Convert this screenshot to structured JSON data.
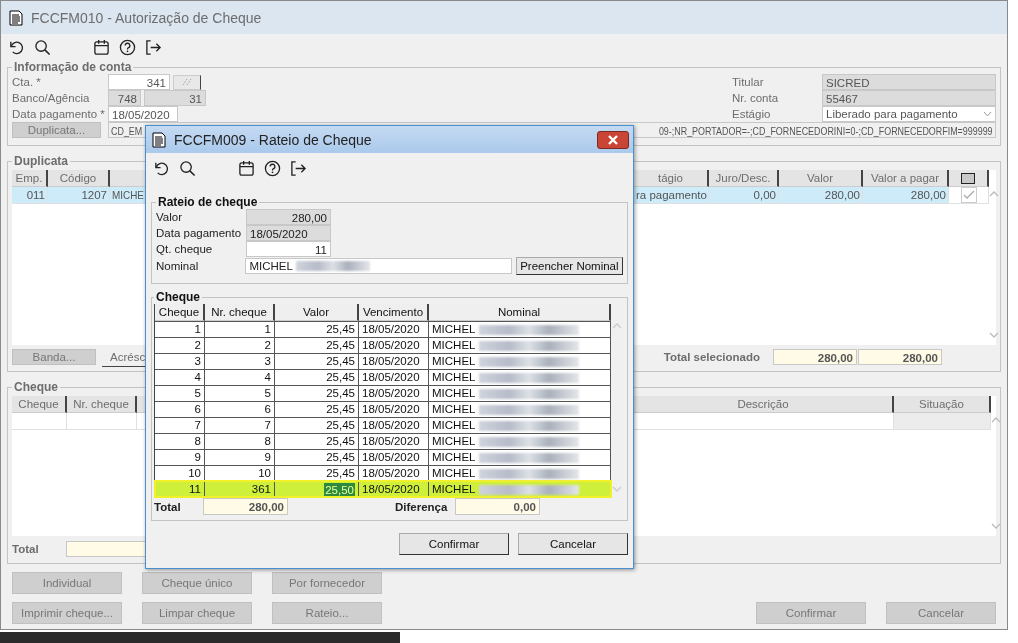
{
  "main_window": {
    "title": "FCCFM010 - Autorização de Cheque"
  },
  "account": {
    "title": "Informação de conta",
    "cta": {
      "label": "Cta. *",
      "value": "341"
    },
    "banco_agencia": {
      "label": "Banco/Agência",
      "banco": "748",
      "agencia": "31"
    },
    "data_pagamento": {
      "label": "Data pagamento *",
      "value": "18/05/2020"
    },
    "duplicata_button": "Duplicata...",
    "filter_start": "CD_EM",
    "filter_end": "09-;NR_PORTADOR=-;CD_FORNECEDORINI=0-;CD_FORNECEDORFIM=999999",
    "titular": {
      "label": "Titular",
      "value": "SICRED"
    },
    "nr_conta": {
      "label": "Nr. conta",
      "value": "55467"
    },
    "estagio": {
      "label": "Estágio",
      "value": "Liberado para pagamento"
    }
  },
  "duplicata": {
    "title": "Duplicata",
    "columns": [
      {
        "kind": "text",
        "label": "Emp."
      },
      {
        "kind": "text",
        "label": "Código"
      },
      {
        "kind": "covered"
      },
      {
        "kind": "text",
        "label": "tágio"
      },
      {
        "kind": "text",
        "label": "Juro/Desc."
      },
      {
        "kind": "text",
        "label": "Valor"
      },
      {
        "kind": "text",
        "label": "Valor a pagar"
      },
      {
        "kind": "checkbox"
      }
    ],
    "rows": [
      {
        "selected": true,
        "cells": [
          "011",
          "1207",
          "MICHE",
          "ra pagamento",
          "0,00",
          "280,00",
          "280,00"
        ],
        "checked": true
      }
    ],
    "banda_button": "Banda...",
    "acresc_tab": "Acrésc",
    "total_label": "Total selecionado",
    "totals": [
      "280,00",
      "280,00"
    ]
  },
  "cheque": {
    "title": "Cheque",
    "columns": [
      {
        "kind": "text",
        "label": "Cheque"
      },
      {
        "kind": "text",
        "label": "Nr. cheque"
      },
      {
        "kind": "covered"
      },
      {
        "kind": "text",
        "label": "Descrição"
      },
      {
        "kind": "text",
        "label": "Situação"
      }
    ],
    "total_label": "Total"
  },
  "button_rows": [
    [
      "Individual",
      "Cheque único",
      "Por fornecedor"
    ],
    [
      "Imprimir cheque...",
      "Limpar cheque",
      "Rateio..."
    ]
  ],
  "footer_buttons": [
    "Confirmar",
    "Cancelar"
  ],
  "dialog": {
    "title": "FCCFM009 - Rateio de Cheque",
    "rateio": {
      "title": "Rateio de cheque",
      "fields": [
        {
          "label": "Valor",
          "value": "280,00",
          "readonly": true
        },
        {
          "label": "Data pagamento",
          "value": "18/05/2020",
          "readonly": true
        },
        {
          "label": "Qt. cheque",
          "value": "11",
          "readonly": false
        }
      ],
      "nominal": {
        "label": "Nominal",
        "value": "MICHEL",
        "blurred": true
      },
      "fill_button": "Preencher Nominal"
    },
    "cheques": {
      "title": "Cheque",
      "columns": [
        "Cheque",
        "Nr. cheque",
        "Valor",
        "Vencimento",
        "Nominal"
      ],
      "rows": [
        {
          "selected": false,
          "editing": false,
          "cheque": "1",
          "nr_cheque": "1",
          "valor": "25,45",
          "vencimento": "18/05/2020",
          "nominal": "MICHEL",
          "blurred": true
        },
        {
          "selected": false,
          "editing": false,
          "cheque": "2",
          "nr_cheque": "2",
          "valor": "25,45",
          "vencimento": "18/05/2020",
          "nominal": "MICHEL",
          "blurred": true
        },
        {
          "selected": false,
          "editing": false,
          "cheque": "3",
          "nr_cheque": "3",
          "valor": "25,45",
          "vencimento": "18/05/2020",
          "nominal": "MICHEL",
          "blurred": true
        },
        {
          "selected": false,
          "editing": false,
          "cheque": "4",
          "nr_cheque": "4",
          "valor": "25,45",
          "vencimento": "18/05/2020",
          "nominal": "MICHEL",
          "blurred": true
        },
        {
          "selected": false,
          "editing": false,
          "cheque": "5",
          "nr_cheque": "5",
          "valor": "25,45",
          "vencimento": "18/05/2020",
          "nominal": "MICHEL",
          "blurred": true
        },
        {
          "selected": false,
          "editing": false,
          "cheque": "6",
          "nr_cheque": "6",
          "valor": "25,45",
          "vencimento": "18/05/2020",
          "nominal": "MICHEL",
          "blurred": true
        },
        {
          "selected": false,
          "editing": false,
          "cheque": "7",
          "nr_cheque": "7",
          "valor": "25,45",
          "vencimento": "18/05/2020",
          "nominal": "MICHEL",
          "blurred": true
        },
        {
          "selected": false,
          "editing": false,
          "cheque": "8",
          "nr_cheque": "8",
          "valor": "25,45",
          "vencimento": "18/05/2020",
          "nominal": "MICHEL",
          "blurred": true
        },
        {
          "selected": false,
          "editing": false,
          "cheque": "9",
          "nr_cheque": "9",
          "valor": "25,45",
          "vencimento": "18/05/2020",
          "nominal": "MICHEL",
          "blurred": true
        },
        {
          "selected": false,
          "editing": false,
          "cheque": "10",
          "nr_cheque": "10",
          "valor": "25,45",
          "vencimento": "18/05/2020",
          "nominal": "MICHEL",
          "blurred": true
        },
        {
          "selected": true,
          "editing": true,
          "cheque": "11",
          "nr_cheque": "361",
          "valor": "25,50",
          "vencimento": "18/05/2020",
          "nominal": "MICHEL",
          "blurred": true
        }
      ],
      "total_label": "Total",
      "total": "280,00",
      "difference_label": "Diferença",
      "difference": "0,00"
    },
    "buttons": [
      "Confirmar",
      "Cancelar"
    ]
  }
}
